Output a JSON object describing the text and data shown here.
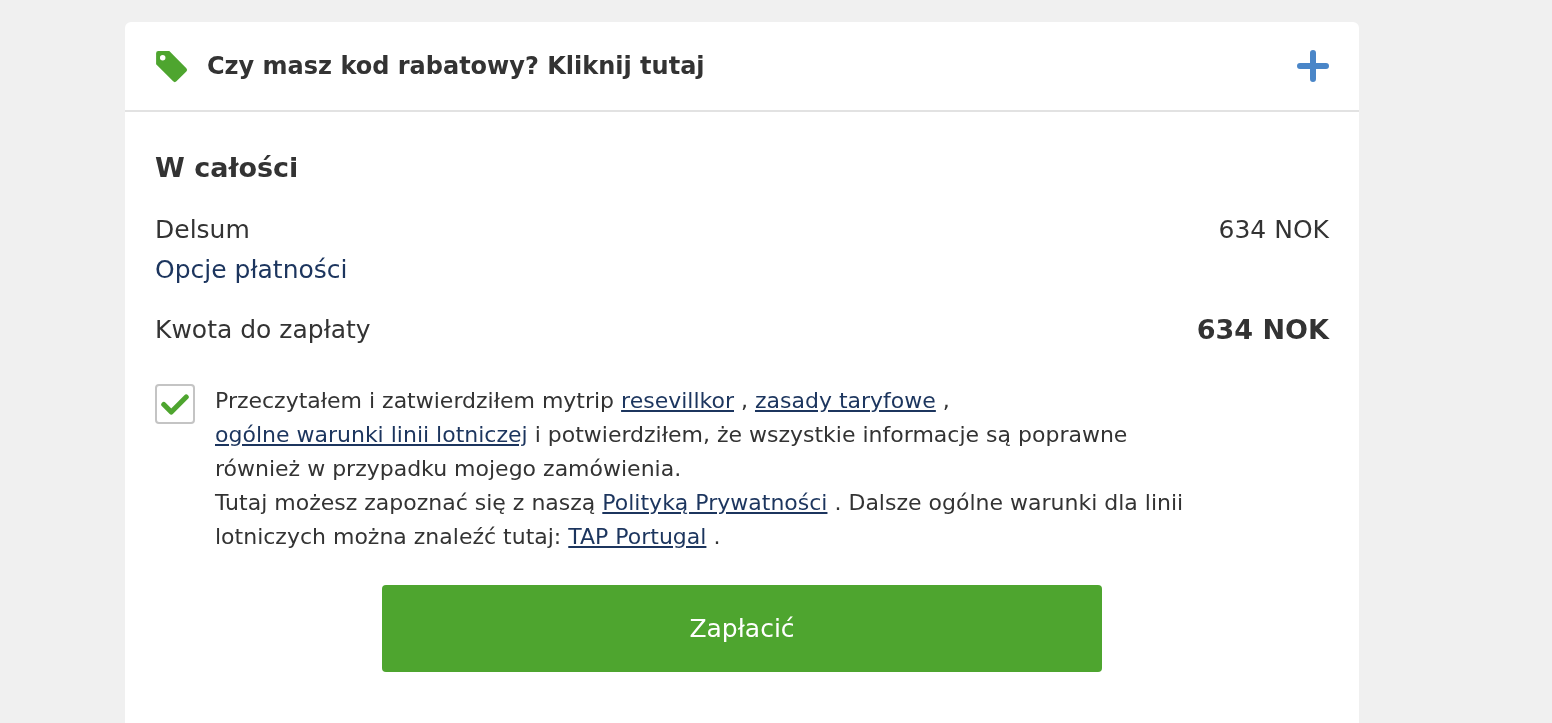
{
  "discount": {
    "prompt": "Czy masz kod rabatowy? Kliknij tutaj",
    "expanded": false
  },
  "summary": {
    "title": "W całości",
    "lines": [
      {
        "kind": "amount",
        "label": "Delsum",
        "value": "634 NOK"
      },
      {
        "kind": "link",
        "label": "Opcje płatności"
      },
      {
        "kind": "total",
        "label": "Kwota do zapłaty",
        "value": "634 NOK"
      }
    ]
  },
  "consent": {
    "checked": true,
    "paragraphs": [
      [
        {
          "kind": "text",
          "text": "Przeczytałem i zatwierdziłem mytrip "
        },
        {
          "kind": "link",
          "text": "resevillkor"
        },
        {
          "kind": "text",
          "text": " , "
        },
        {
          "kind": "link",
          "text": "zasady taryfowe"
        },
        {
          "kind": "text",
          "text": " , "
        },
        {
          "kind": "link",
          "text": "ogólne warunki linii lotniczej"
        },
        {
          "kind": "text",
          "text": " i potwierdziłem, że wszystkie informacje są poprawne również w przypadku mojego zamówienia."
        }
      ],
      [
        {
          "kind": "text",
          "text": "Tutaj możesz zapoznać się z naszą "
        },
        {
          "kind": "link",
          "text": "Polityką Prywatności"
        },
        {
          "kind": "text",
          "text": " . Dalsze ogólne warunki dla linii lotniczych można znaleźć tutaj: "
        },
        {
          "kind": "link",
          "text": "TAP Portugal"
        },
        {
          "kind": "text",
          "text": " ."
        }
      ]
    ]
  },
  "pay_button": {
    "label": "Zapłacić"
  }
}
